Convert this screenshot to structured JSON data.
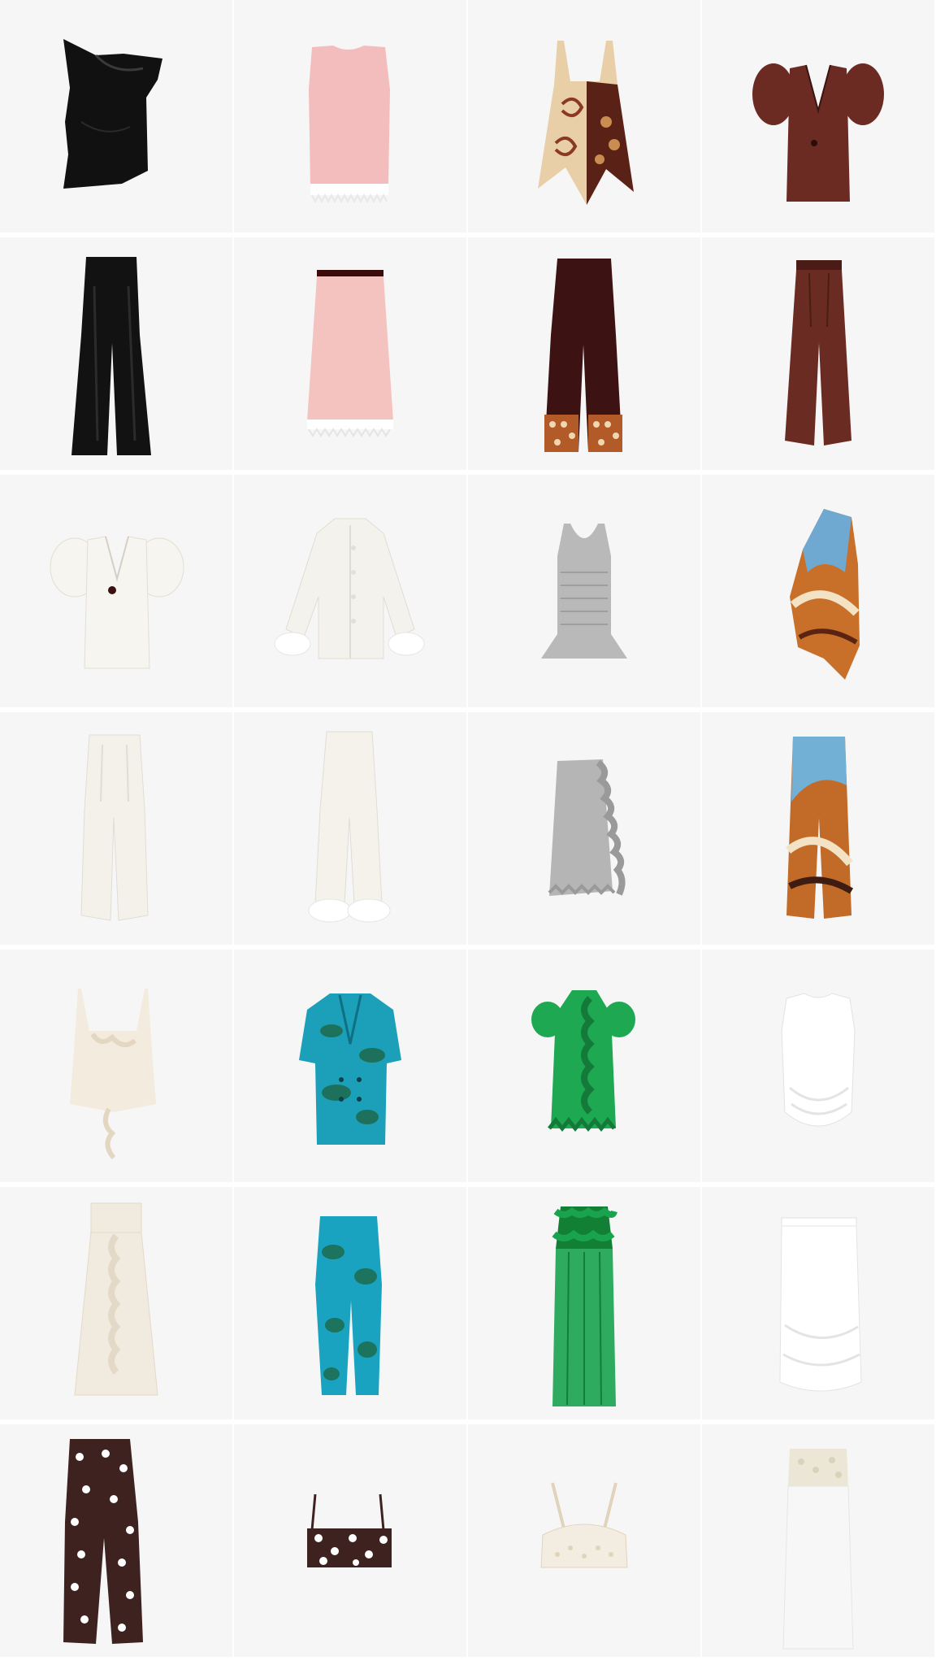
{
  "grid": {
    "products": [
      {
        "icon": "black-asymmetric-satin-top-icon",
        "colors": {
          "primary": "#111111",
          "secondary": "#2a2a2a"
        }
      },
      {
        "icon": "pink-sleeveless-fringe-top-icon",
        "colors": {
          "primary": "#f4bdbd",
          "secondary": "#ffffff"
        }
      },
      {
        "icon": "patterned-scarf-halter-top-icon",
        "colors": {
          "primary": "#e8cfa8",
          "secondary": "#5a2216"
        }
      },
      {
        "icon": "brown-puff-sleeve-blazer-icon",
        "colors": {
          "primary": "#6b2a22",
          "secondary": "#3a1410"
        }
      },
      {
        "icon": "black-wide-leg-trousers-icon",
        "colors": {
          "primary": "#121212",
          "secondary": "#2b2b2b"
        }
      },
      {
        "icon": "pink-fringe-midi-skirt-icon",
        "colors": {
          "primary": "#f4c3c0",
          "secondary": "#ffffff"
        }
      },
      {
        "icon": "burgundy-patterned-hem-trousers-icon",
        "colors": {
          "primary": "#3c1312",
          "secondary": "#b25a28"
        }
      },
      {
        "icon": "brown-high-waist-wide-trousers-icon",
        "colors": {
          "primary": "#6a2c22",
          "secondary": "#4a1c15"
        }
      },
      {
        "icon": "white-puff-sleeve-blazer-icon",
        "colors": {
          "primary": "#f7f5f0",
          "secondary": "#2a1010"
        }
      },
      {
        "icon": "white-feather-cuff-shirt-icon",
        "colors": {
          "primary": "#f4f2ec",
          "secondary": "#ffffff"
        }
      },
      {
        "icon": "grey-smocked-peplum-tank-icon",
        "colors": {
          "primary": "#b9b9b9",
          "secondary": "#9e9e9e"
        }
      },
      {
        "icon": "swirl-print-one-shoulder-top-icon",
        "colors": {
          "primary": "#c8702a",
          "secondary": "#6fa9d1"
        }
      },
      {
        "icon": "white-wide-leg-trousers-icon",
        "colors": {
          "primary": "#f3f1ea",
          "secondary": "#e0ddd4"
        }
      },
      {
        "icon": "white-feather-hem-pajama-trousers-icon",
        "colors": {
          "primary": "#f4f2ea",
          "secondary": "#ffffff"
        }
      },
      {
        "icon": "grey-ruffle-smocked-skirt-icon",
        "colors": {
          "primary": "#b5b5b5",
          "secondary": "#9a9a9a"
        }
      },
      {
        "icon": "swirl-print-wide-trousers-icon",
        "colors": {
          "primary": "#c26a28",
          "secondary": "#73b0d6"
        }
      },
      {
        "icon": "cream-ruffle-camisole-icon",
        "colors": {
          "primary": "#f3ebdd",
          "secondary": "#e4d7c1"
        }
      },
      {
        "icon": "teal-print-double-breasted-jacket-icon",
        "colors": {
          "primary": "#1c9fb8",
          "secondary": "#1e6a4c"
        }
      },
      {
        "icon": "green-ruffle-sheer-top-icon",
        "colors": {
          "primary": "#1da851",
          "secondary": "#137a39"
        }
      },
      {
        "icon": "white-draped-sleeveless-top-icon",
        "colors": {
          "primary": "#ffffff",
          "secondary": "#e6e6e6"
        }
      },
      {
        "icon": "cream-ruffle-maxi-skirt-icon",
        "colors": {
          "primary": "#f1ebdf",
          "secondary": "#e3d9c6"
        }
      },
      {
        "icon": "teal-print-capri-trousers-icon",
        "colors": {
          "primary": "#19a3c0",
          "secondary": "#1d6b4d"
        }
      },
      {
        "icon": "green-sheer-ruffle-maxi-skirt-icon",
        "colors": {
          "primary": "#1aa34e",
          "secondary": "#128034"
        }
      },
      {
        "icon": "white-draped-midi-skirt-icon",
        "colors": {
          "primary": "#ffffff",
          "secondary": "#e4e4e4"
        }
      },
      {
        "icon": "brown-polka-dot-trousers-icon",
        "colors": {
          "primary": "#3d2220",
          "secondary": "#ffffff"
        }
      },
      {
        "icon": "brown-polka-dot-bandeau-top-icon",
        "colors": {
          "primary": "#3d2220",
          "secondary": "#ffffff"
        }
      },
      {
        "icon": "cream-lace-bralette-top-icon",
        "colors": {
          "primary": "#f3ece0",
          "secondary": "#e2d4bc"
        }
      },
      {
        "icon": "white-lace-waist-maxi-skirt-icon",
        "colors": {
          "primary": "#f7f7f7",
          "secondary": "#ece6d6"
        }
      }
    ]
  }
}
